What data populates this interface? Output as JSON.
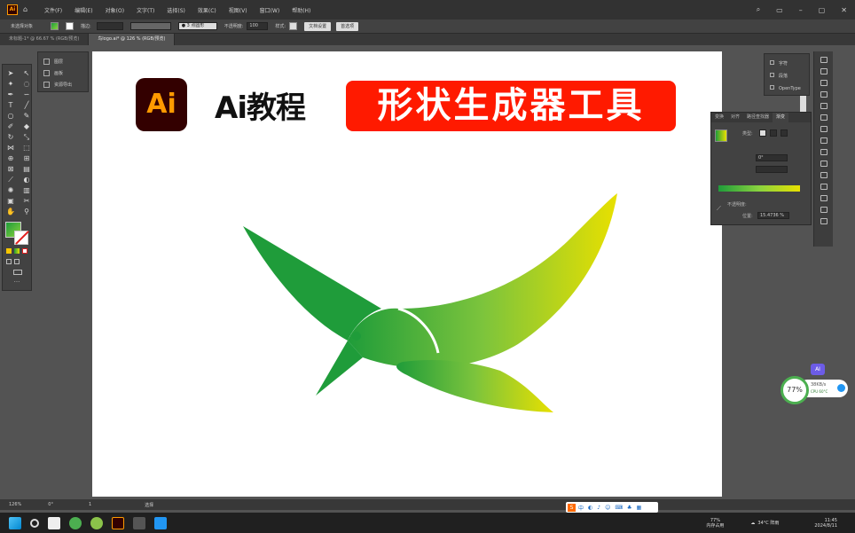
{
  "menubar": {
    "app_icon": "Ai",
    "items": [
      "文件(F)",
      "编辑(E)",
      "对象(O)",
      "文字(T)",
      "选择(S)",
      "效果(C)",
      "视图(V)",
      "窗口(W)",
      "帮助(H)"
    ]
  },
  "controlbar": {
    "left_label": "未选择对象",
    "stroke_label": "描边:",
    "pt_value": "● 3 点圆形",
    "opacity_label": "不透明度:",
    "opacity_value": "100",
    "style_label": "样式:",
    "doc_setup_button": "文档设置",
    "preferences_button": "首选项"
  },
  "tabs": [
    {
      "label": "未标题-1* @ 66.67 % (RGB/预览)",
      "active": false
    },
    {
      "label": "鸟logo.ai* @ 126 % (RGB/预览)",
      "active": true
    }
  ],
  "layers_panel": {
    "items": [
      "图层",
      "画板",
      "资源导出"
    ]
  },
  "artboard": {
    "badge_text": "Ai",
    "heading": "Ai教程",
    "banner": "形状生成器工具"
  },
  "char_panel": {
    "items": [
      "字符",
      "段落",
      "OpenType"
    ]
  },
  "gradient_panel": {
    "tabs": [
      "变换",
      "对齐",
      "路径查找器",
      "渐变"
    ],
    "type_label": "类型:",
    "angle_value": "0°",
    "opacity_label": "不透明度:",
    "location_label": "位置:",
    "location_value": "15.4736 %"
  },
  "floating": {
    "ai_label": "AI",
    "cpu_percent": "77%",
    "cpu_line1": "38KB/s",
    "cpu_line2": "CPU 60°C"
  },
  "statusbar": {
    "zoom": "126%",
    "rotation": "0°",
    "page": "1",
    "tool": "选择"
  },
  "taskbar": {
    "memory_percent": "77%",
    "memory_label": "内存占用",
    "weather": "34°C 阵雨",
    "time": "11:45",
    "date": "2024/8/11"
  },
  "colors": {
    "gradient_start": "#1f9c3a",
    "gradient_end": "#e8e000",
    "banner": "#ff1a00",
    "ai_badge_bg": "#330000",
    "ai_badge_fg": "#ff9a00"
  }
}
